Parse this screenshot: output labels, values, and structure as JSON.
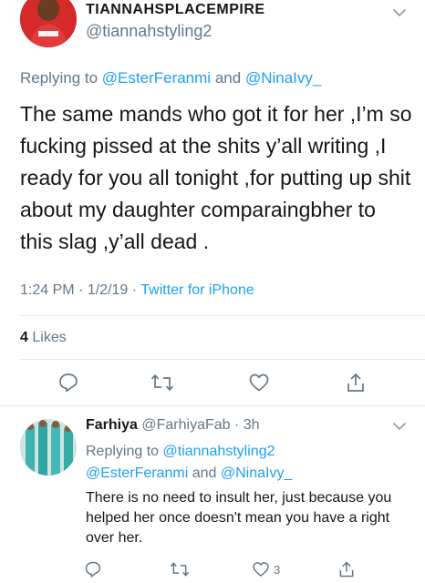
{
  "main_tweet": {
    "display_name": "TIANNAHSPLACEMPIRE",
    "handle": "@tiannahstyling2",
    "replying_prefix": "Replying to",
    "replying_user1": "@EsterFeranmi",
    "replying_and": "and",
    "replying_user2": "@NinaIvy_",
    "text": "The same mands who got it for her ,I’m so fucking pissed at the shits y’all writing ,I ready for you all tonight ,for putting up shit about my daughter comparaingbher to this slag ,y’all dead .",
    "time": "1:24 PM",
    "date": "1/2/19",
    "source": "Twitter for iPhone",
    "sep": "·",
    "likes_count": "4",
    "likes_label": "Likes"
  },
  "reply": {
    "display_name": "Farhiya",
    "handle": "@FarhiyaFab",
    "age": "3h",
    "sep": "·",
    "replying_prefix": "Replying to",
    "replying_user1": "@tiannahstyling2",
    "replying_user2": "@EsterFeranmi",
    "replying_and": "and",
    "replying_user3": "@NinaIvy_",
    "text": "There is no need to insult her, just because you helped her once doesn't mean you have a right over her.",
    "like_count": "3"
  },
  "icons": {
    "reply": "reply-icon",
    "retweet": "retweet-icon",
    "like": "heart-icon",
    "share": "share-icon",
    "menu": "chevron-down-icon"
  },
  "colors": {
    "link": "#1da1f2",
    "secondary": "#657786",
    "text": "#14171a",
    "divider": "#e1e8ed"
  }
}
